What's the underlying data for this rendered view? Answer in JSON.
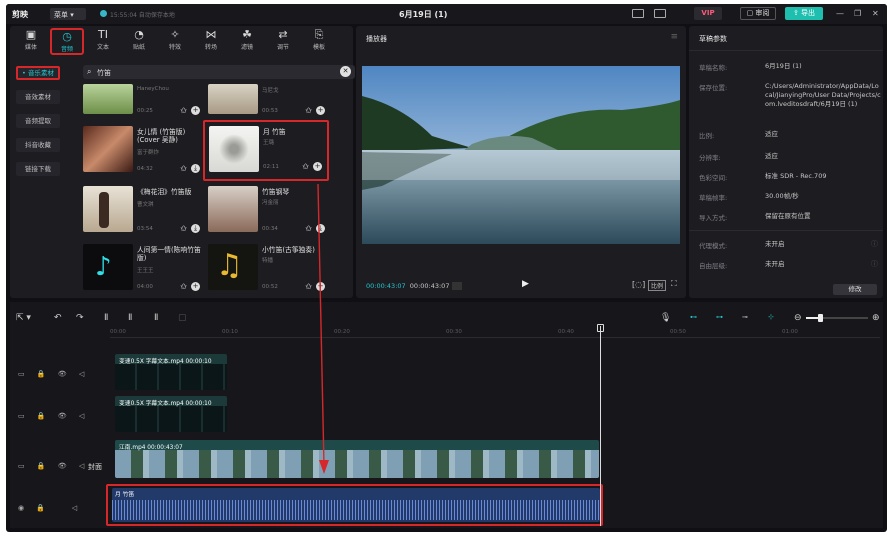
{
  "app": {
    "name": "剪映",
    "menu_label": "菜单",
    "autosave": "15:55:04 自动保存本地",
    "doc_title": "6月19日 (1)"
  },
  "topbar": {
    "vip_label": "VIP",
    "review_label": "审阅",
    "export_label": "导出"
  },
  "tools": [
    {
      "label": "媒体",
      "icon": "media-icon"
    },
    {
      "label": "音频",
      "icon": "audio-icon",
      "active": true
    },
    {
      "label": "文本",
      "icon": "text-icon"
    },
    {
      "label": "贴纸",
      "icon": "sticker-icon"
    },
    {
      "label": "特效",
      "icon": "effects-icon"
    },
    {
      "label": "转场",
      "icon": "transition-icon"
    },
    {
      "label": "滤镜",
      "icon": "filter-icon"
    },
    {
      "label": "调节",
      "icon": "adjust-icon"
    },
    {
      "label": "模板",
      "icon": "template-icon"
    }
  ],
  "sidebar": [
    {
      "label": "• 音乐素材",
      "active": true
    },
    {
      "label": "音效素材"
    },
    {
      "label": "音频提取"
    },
    {
      "label": "抖音收藏"
    },
    {
      "label": "链接下载"
    }
  ],
  "search": {
    "value": "竹笛"
  },
  "cards": [
    {
      "title": "",
      "artist": "HaneyChou",
      "duration": "00:25"
    },
    {
      "title": "",
      "artist": "马尼戈",
      "duration": "00:53"
    },
    {
      "title": "女儿情 (竹笛版) (Cover 吴静)",
      "artist": "富于群炸",
      "duration": "04:32"
    },
    {
      "title": "月 竹笛",
      "artist": "王璐",
      "duration": "02:11"
    },
    {
      "title": "《梅花泪》竹笛版",
      "artist": "曹文琪",
      "duration": "03:54"
    },
    {
      "title": "竹笛钢琴",
      "artist": "冯金丽",
      "duration": "00:34"
    },
    {
      "title": "人间第一情(陈响竹笛版)",
      "artist": "王王王",
      "duration": "04:00"
    },
    {
      "title": "小竹笛(古筝独奏)",
      "artist": "特播",
      "duration": "00:52"
    }
  ],
  "player": {
    "title": "播放器",
    "current": "00:00:43:07",
    "total": "00:00:43:07",
    "ratio_label": "比例"
  },
  "properties": {
    "title": "草稿参数",
    "rows": [
      {
        "k": "草稿名称:",
        "v": "6月19日 (1)"
      },
      {
        "k": "保存位置:",
        "v": "C:/Users/Administrator/AppData/Local/JianyingPro/User Data/Projects/com.lveditosdraft/6月19日 (1)"
      },
      {
        "k": "比例:",
        "v": "适应"
      },
      {
        "k": "分辨率:",
        "v": "适应"
      },
      {
        "k": "色彩空间:",
        "v": "标准 SDR - Rec.709"
      },
      {
        "k": "草稿帧率:",
        "v": "30.00帧/秒"
      },
      {
        "k": "导入方式:",
        "v": "保留在原有位置"
      },
      {
        "k": "代理模式:",
        "v": "未开启"
      },
      {
        "k": "自由层级:",
        "v": "未开启"
      }
    ],
    "edit_label": "修改"
  },
  "timeline": {
    "ticks": [
      "00:00",
      "00:10",
      "00:20",
      "00:30",
      "00:40",
      "00:50",
      "01:00"
    ],
    "text_clip_1": "变速0.5X  字幕文本.mp4  00:00:10",
    "text_clip_2": "变速0.5X  字幕文本.mp4  00:00:10",
    "video_clip": "江南.mp4  00:00:43:07",
    "cover_label": "封面",
    "audio_clip": "月 竹笛"
  }
}
